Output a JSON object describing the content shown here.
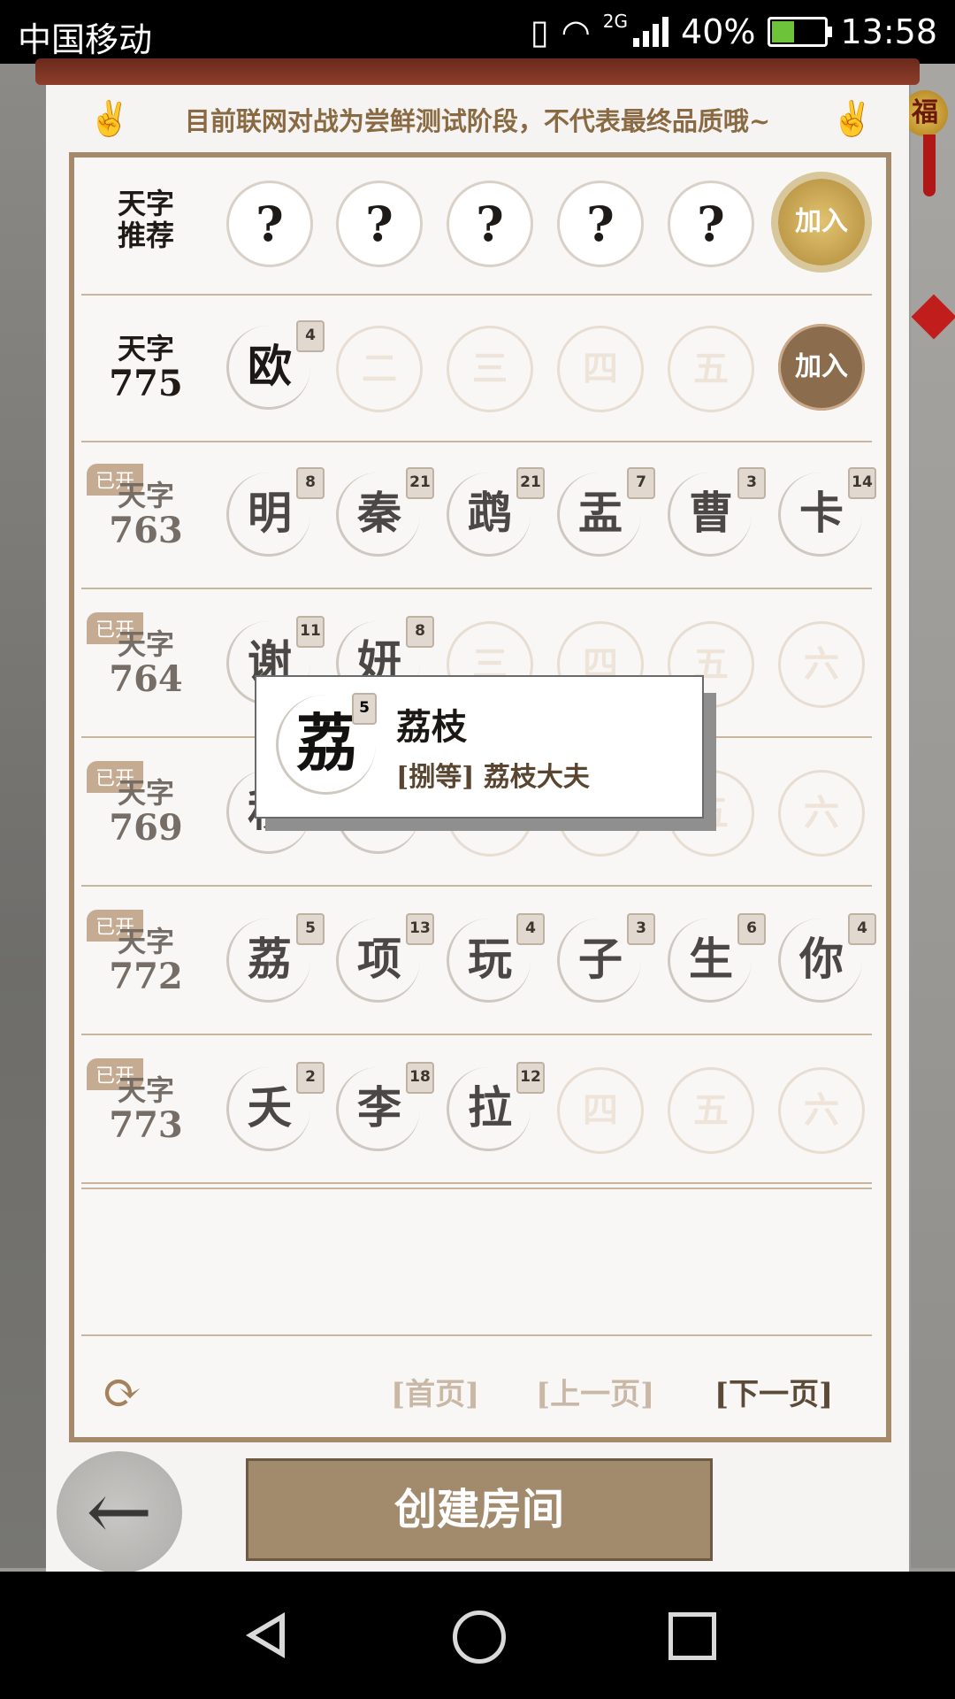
{
  "status_bar": {
    "carrier": "中国移动",
    "network": "2G",
    "battery": "40%",
    "time": "13:58"
  },
  "banner": {
    "notice": "目前联网对战为尝鲜测试阶段，不代表最终品质哦~",
    "fu": "福"
  },
  "rows": [
    {
      "l1": "天字",
      "l2": "推荐",
      "opened": false,
      "slots": [
        {
          "c": "?",
          "t": "q"
        },
        {
          "c": "?",
          "t": "q"
        },
        {
          "c": "?",
          "t": "q"
        },
        {
          "c": "?",
          "t": "q"
        },
        {
          "c": "?",
          "t": "q"
        }
      ],
      "join": "加入",
      "join_style": "gold"
    },
    {
      "l1": "天字",
      "l2": "775",
      "opened": false,
      "slots": [
        {
          "c": "欧",
          "t": "p",
          "n": "4"
        },
        {
          "c": "二",
          "t": "e"
        },
        {
          "c": "三",
          "t": "e"
        },
        {
          "c": "四",
          "t": "e"
        },
        {
          "c": "五",
          "t": "e"
        }
      ],
      "join": "加入",
      "join_style": "brown"
    },
    {
      "l1": "天字",
      "l2": "763",
      "opened": true,
      "tag": "已开",
      "slots": [
        {
          "c": "明",
          "t": "p",
          "n": "8"
        },
        {
          "c": "秦",
          "t": "p",
          "n": "21"
        },
        {
          "c": "鹉",
          "t": "p",
          "n": "21"
        },
        {
          "c": "盂",
          "t": "p",
          "n": "7"
        },
        {
          "c": "曹",
          "t": "p",
          "n": "3"
        },
        {
          "c": "卡",
          "t": "p",
          "n": "14"
        }
      ]
    },
    {
      "l1": "天字",
      "l2": "764",
      "opened": true,
      "tag": "已开",
      "slots": [
        {
          "c": "谢",
          "t": "p",
          "n": "11"
        },
        {
          "c": "妍",
          "t": "p",
          "n": "8"
        },
        {
          "c": "三",
          "t": "e"
        },
        {
          "c": "四",
          "t": "e"
        },
        {
          "c": "五",
          "t": "e"
        },
        {
          "c": "六",
          "t": "e"
        }
      ]
    },
    {
      "l1": "天字",
      "l2": "769",
      "opened": true,
      "tag": "已开",
      "slots": [
        {
          "c": "秋",
          "t": "p"
        },
        {
          "c": "坑",
          "t": "p"
        },
        {
          "c": "三",
          "t": "e"
        },
        {
          "c": "四",
          "t": "e"
        },
        {
          "c": "五",
          "t": "e"
        },
        {
          "c": "六",
          "t": "e"
        }
      ]
    },
    {
      "l1": "天字",
      "l2": "772",
      "opened": true,
      "tag": "已开",
      "slots": [
        {
          "c": "荔",
          "t": "p",
          "n": "5"
        },
        {
          "c": "项",
          "t": "p",
          "n": "13"
        },
        {
          "c": "玩",
          "t": "p",
          "n": "4"
        },
        {
          "c": "子",
          "t": "p",
          "n": "3"
        },
        {
          "c": "生",
          "t": "p",
          "n": "6"
        },
        {
          "c": "你",
          "t": "p",
          "n": "4"
        }
      ]
    },
    {
      "l1": "天字",
      "l2": "773",
      "opened": true,
      "tag": "已开",
      "slots": [
        {
          "c": "夭",
          "t": "p",
          "n": "2"
        },
        {
          "c": "李",
          "t": "p",
          "n": "18"
        },
        {
          "c": "拉",
          "t": "p",
          "n": "12"
        },
        {
          "c": "四",
          "t": "e"
        },
        {
          "c": "五",
          "t": "e"
        },
        {
          "c": "六",
          "t": "e"
        }
      ]
    }
  ],
  "popup": {
    "char": "荔",
    "level": "5",
    "name": "荔枝",
    "rank": "[捌等] 荔枝大夫"
  },
  "pager": {
    "first": "[首页]",
    "prev": "[上一页]",
    "next": "[下一页]"
  },
  "create_room": "创建房间"
}
